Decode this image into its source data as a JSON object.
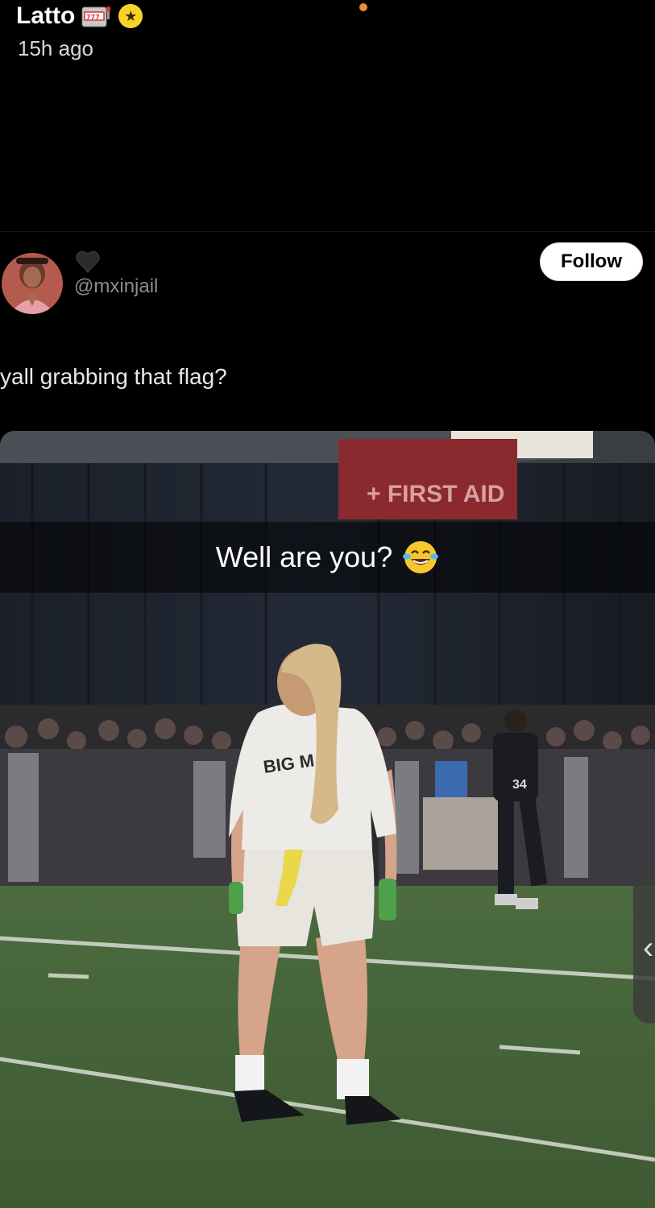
{
  "story": {
    "user_name": "Latto",
    "name_emoji_icon": "slot-machine-icon",
    "badge_icon": "star-badge-icon",
    "time_ago": "15h ago"
  },
  "post": {
    "handle": "@mxinjail",
    "heart_icon": "black-heart-icon",
    "follow_label": "Follow",
    "caption": "yall grabbing that flag?"
  },
  "video": {
    "overlay_caption": "Well are you?",
    "overlay_emoji_icon": "laughing-tears-icon",
    "sign_text": "+ FIRST AID",
    "jersey_text": "BIG M",
    "player_number": "34"
  },
  "colors": {
    "background": "#000000",
    "follow_bg": "#ffffff",
    "badge": "#f7d22b",
    "progress_dot": "#f28a33"
  }
}
